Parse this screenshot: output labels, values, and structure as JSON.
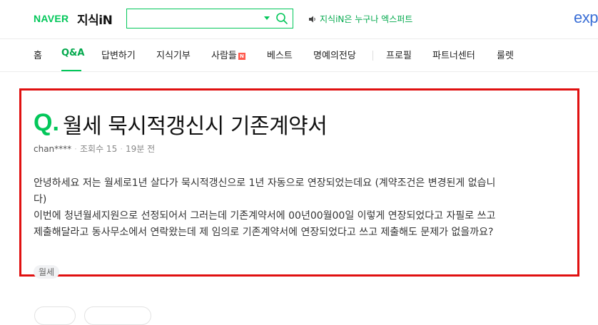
{
  "header": {
    "logo_naver": "NAVER",
    "logo_service": "지식iN",
    "search": {
      "value": "",
      "placeholder": ""
    },
    "notice": "지식iN은 누구나 엑스퍼트",
    "partner_logo": "exp"
  },
  "nav": {
    "items": [
      "홈",
      "Q&A",
      "답변하기",
      "지식기부",
      "사람들",
      "베스트",
      "명예의전당",
      "프로필",
      "파트너센터",
      "룰렛"
    ],
    "active": "Q&A",
    "new_badge": "N"
  },
  "question": {
    "mark": "Q.",
    "title": "월세 묵시적갱신시 기존계약서",
    "author": "chan****",
    "views": "조회수 15",
    "time": "19분 전",
    "body": [
      "안녕하세요 저는 월세로1년 살다가 묵시적갱신으로 1년 자동으로 연장되었는데요 (계약조건은 변경된게 없습니",
      "다)",
      "이번에 청년월세지원으로 선정되어서 그러는데 기존계약서에 00년00월00일 이렇게 연장되었다고 자필로 쓰고",
      "제출해달라고 동사무소에서 연락왔는데 제 임의로 기존계약서에 연장되었다고 쓰고 제출해도 문제가 없을까요?"
    ],
    "tag": "월세"
  },
  "colors": {
    "brand_green": "#03c75a",
    "highlight_red": "#e01010",
    "new_badge": "#ff5a4e"
  }
}
